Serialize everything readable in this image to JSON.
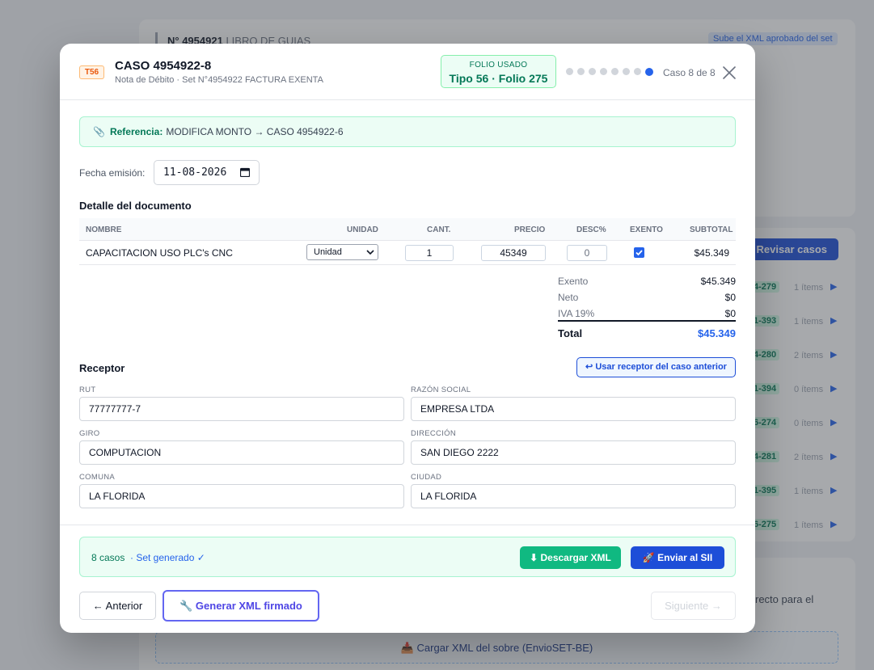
{
  "background": {
    "doc_number": "N° 4954921",
    "doc_title": "LIBRO DE GUIAS",
    "hint": "Sube el XML aprobado del set",
    "review_button": "Revisar casos",
    "rows": [
      {
        "code": "4-279",
        "items": "1 ítems"
      },
      {
        "code": "1-393",
        "items": "1 ítems"
      },
      {
        "code": "4-280",
        "items": "2 ítems"
      },
      {
        "code": "1-394",
        "items": "0 ítems"
      },
      {
        "code": "6-274",
        "items": "0 ítems"
      },
      {
        "code": "4-281",
        "items": "2 ítems"
      },
      {
        "code": "1-395",
        "items": "1 ítems"
      },
      {
        "code": "6-275",
        "items": "1 ítems"
      }
    ],
    "side_text_1": "recto para el",
    "side_text_2": "",
    "upload_label": "Cargar XML del sobre (EnvioSET-BE)"
  },
  "modal": {
    "type_badge": "T56",
    "title": "CASO 4954922-8",
    "subtitle": "Nota de Débito · Set N°4954922 FACTURA EXENTA",
    "folio_label": "FOLIO USADO",
    "folio_value": "Tipo 56 · Folio 275",
    "case_counter": "Caso 8 de 8",
    "total_steps": 8,
    "current_step": 8,
    "reference_label": "Referencia:",
    "reference_text": "MODIFICA MONTO → CASO 4954922-6",
    "date_label": "Fecha emisión:",
    "date_value": "11-08-2026",
    "detail_title": "Detalle del documento",
    "table_headers": {
      "nombre": "NOMBRE",
      "unidad": "UNIDAD",
      "cant": "CANT.",
      "precio": "PRECIO",
      "desc": "DESC%",
      "exento": "EXENTO",
      "subtotal": "SUBTOTAL"
    },
    "items": [
      {
        "nombre": "CAPACITACION USO PLC's CNC",
        "unidad": "Unidad",
        "cant": "1",
        "precio": "45349",
        "desc": "0",
        "exento": true,
        "subtotal": "$45.349"
      }
    ],
    "totals": {
      "exento_label": "Exento",
      "exento": "$45.349",
      "neto_label": "Neto",
      "neto": "$0",
      "iva_label": "IVA 19%",
      "iva": "$0",
      "total_label": "Total",
      "total": "$45.349"
    },
    "receptor_title": "Receptor",
    "reuse_button": "↩ Usar receptor del caso anterior",
    "receptor": {
      "rut_label": "RUT",
      "rut": "77777777-7",
      "razon_label": "RAZÓN SOCIAL",
      "razon": "EMPRESA LTDA",
      "giro_label": "GIRO",
      "giro": "COMPUTACION",
      "direccion_label": "DIRECCIÓN",
      "direccion": "SAN DIEGO 2222",
      "comuna_label": "COMUNA",
      "comuna": "LA FLORIDA",
      "ciudad_label": "CIUDAD",
      "ciudad": "LA FLORIDA"
    },
    "generated": {
      "count": "8 casos",
      "status": "· Set generado ✓",
      "download_button": "⬇ Descargar XML",
      "send_button": "🚀 Enviar al SII"
    },
    "nav": {
      "prev": "← Anterior",
      "sign": "🔧 Generar XML firmado",
      "next": "Siguiente →"
    }
  },
  "colors": {
    "accent": "#2563eb",
    "success": "#10b981",
    "primary": "#1d4ed8",
    "sign": "#6366f1",
    "badge_orange": "#ea580c"
  }
}
